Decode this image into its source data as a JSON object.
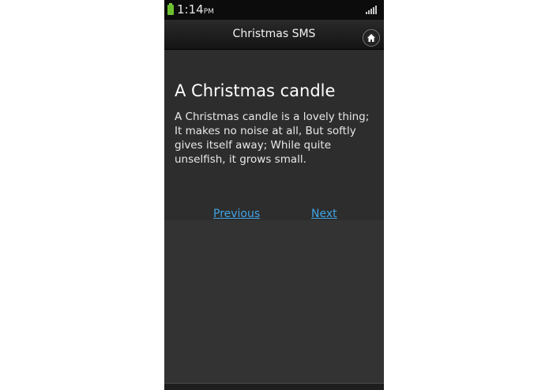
{
  "status_bar": {
    "time": "1:14",
    "ampm": "PM"
  },
  "header": {
    "title": "Christmas SMS"
  },
  "sms": {
    "title": "A Christmas candle",
    "body": "A Christmas candle is a lovely thing; It makes no noise at all, But softly gives itself away; While quite unselfish, it grows small."
  },
  "nav": {
    "previous_label": "Previous",
    "next_label": "Next"
  },
  "colors": {
    "background": "#2e2e2e",
    "link": "#3fa3e6",
    "battery": "#6cc02e"
  }
}
